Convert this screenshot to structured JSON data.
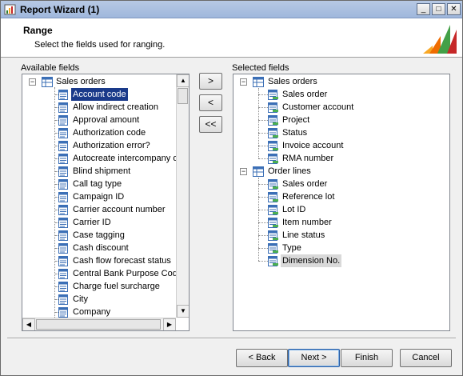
{
  "window": {
    "title": "Report Wizard (1)"
  },
  "header": {
    "title": "Range",
    "subtitle": "Select the fields used for ranging."
  },
  "available": {
    "label": "Available fields",
    "root": "Sales orders",
    "items": [
      "Account code",
      "Allow indirect creation",
      "Approval amount",
      "Authorization code",
      "Authorization error?",
      "Autocreate intercompany o",
      "Blind shipment",
      "Call tag type",
      "Campaign ID",
      "Carrier account number",
      "Carrier ID",
      "Case tagging",
      "Cash discount",
      "Cash flow forecast status",
      "Central Bank Purpose Code",
      "Charge fuel surcharge",
      "City",
      "Company"
    ]
  },
  "selected": {
    "label": "Selected fields",
    "groups": [
      {
        "name": "Sales orders",
        "items": [
          "Sales order",
          "Customer account",
          "Project",
          "Status",
          "Invoice account",
          "RMA number"
        ]
      },
      {
        "name": "Order lines",
        "items": [
          "Sales order",
          "Reference lot",
          "Lot ID",
          "Item number",
          "Line status",
          "Type",
          "Dimension No."
        ]
      }
    ]
  },
  "move_buttons": {
    "add": ">",
    "remove": "<",
    "remove_all": "<<"
  },
  "footer": {
    "back": "< Back",
    "next": "Next >",
    "finish": "Finish",
    "cancel": "Cancel"
  },
  "colors": {
    "selection": "#1a3a8a",
    "titlebar": "#b7c9e4"
  }
}
